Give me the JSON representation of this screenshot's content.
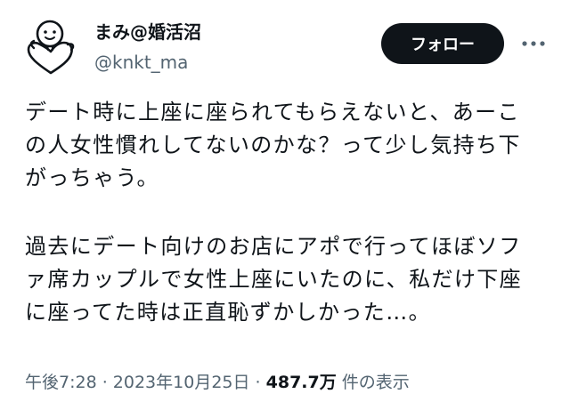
{
  "author": {
    "display_name": "まみ@婚活沼",
    "handle": "@knkt_ma"
  },
  "actions": {
    "follow_label": "フォロー",
    "more_icon": "more-dots-icon"
  },
  "tweet": {
    "lines_paragraph1": [
      "デート時に上座に座られてもらえないと、あーこ",
      "の人女性慣れしてないのかな？って少し気持ち下",
      "がっちゃう。"
    ],
    "lines_paragraph2": [
      "過去にデート向けのお店にアポで行ってほぼソフ",
      "ァ席カップルで女性上座にいたのに、私だけ下座",
      "に座ってた時は正直恥ずかしかった…。"
    ]
  },
  "meta": {
    "time": "午後7:28",
    "separator1": " · ",
    "date": "2023年10月25日",
    "separator2": " · ",
    "views_count": "487.7万",
    "views_label": " 件の表示"
  },
  "colors": {
    "text": "#0f1419",
    "secondary": "#536471",
    "button_bg": "#0f1419",
    "button_text": "#ffffff"
  }
}
